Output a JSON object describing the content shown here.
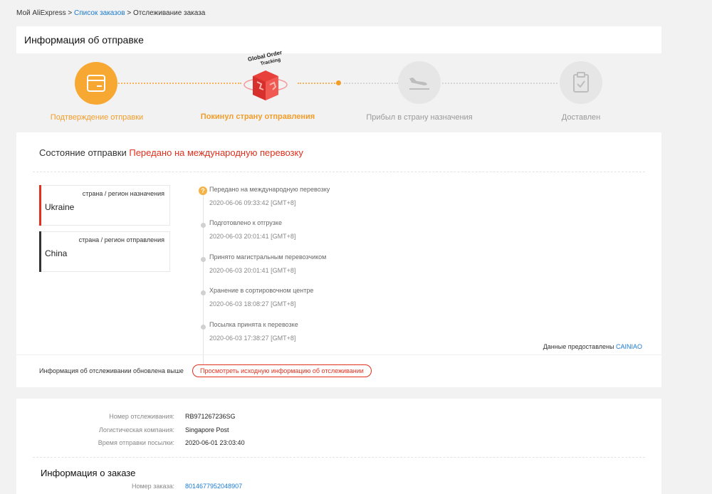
{
  "breadcrumb": {
    "home": "Мой AliExpress",
    "sep": ">",
    "orders": "Список заказов",
    "current": "Отслеживание заказа"
  },
  "shipping": {
    "title": "Информация об отправке",
    "badge_line1": "Global Order",
    "badge_line2": "Tracking",
    "steps": [
      {
        "label": "Подтверждение отправки",
        "state": "done",
        "icon": "package-icon"
      },
      {
        "label": "Покинул страну отправления",
        "state": "current",
        "icon": "global-box-icon"
      },
      {
        "label": "Прибыл в страну назначения",
        "state": "pending",
        "icon": "plane-landing-icon"
      },
      {
        "label": "Доставлен",
        "state": "pending",
        "icon": "clipboard-check-icon"
      }
    ],
    "status_label": "Состояние отправки",
    "status_value": "Передано на международную перевозку",
    "destination": {
      "label": "страна / регион назначения",
      "country": "Ukraine"
    },
    "origin": {
      "label": "страна / регион отправления",
      "country": "China"
    },
    "events": [
      {
        "title": "Передано на международную перевозку",
        "time": "2020-06-06 09:33:42 [GMT+8]"
      },
      {
        "title": "Подготовлено к отгрузке",
        "time": "2020-06-03 20:01:41 [GMT+8]"
      },
      {
        "title": "Принято магистральным перевозчиком",
        "time": "2020-06-03 20:01:41 [GMT+8]"
      },
      {
        "title": "Хранение в сортировочном центре",
        "time": "2020-06-03 18:08:27 [GMT+8]"
      },
      {
        "title": "Посылка принята к перевозке",
        "time": "2020-06-03 17:38:27 [GMT+8]"
      }
    ],
    "first_event_marker": "?",
    "provider_prefix": "Данные предоставлены",
    "provider_name": "CAINIAO",
    "updated_text": "Информация об отслеживании обновлена выше",
    "original_button": "Просмотреть исходную информацию об отслеживании"
  },
  "details": {
    "rows": [
      {
        "key": "Номер отслеживания:",
        "value": "RB971267236SG"
      },
      {
        "key": "Логистическая компания:",
        "value": "Singapore Post"
      },
      {
        "key": "Время отправки посылки:",
        "value": "2020-06-01 23:03:40"
      }
    ],
    "order_title": "Информация о заказе",
    "order_number_key": "Номер заказа:",
    "order_number_value": "8014677952048907"
  },
  "colors": {
    "accent_orange": "#f7a832",
    "status_red": "#e0301e",
    "link_blue": "#1a7bd3"
  }
}
